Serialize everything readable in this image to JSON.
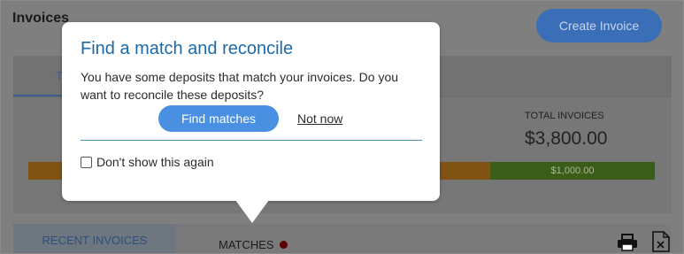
{
  "page": {
    "title": "Invoices",
    "create_button": "Create Invoice"
  },
  "summary": {
    "tab_partial": "T",
    "total_label": "TOTAL INVOICES",
    "total_value": "$3,800.00",
    "green_bar_label": "$1,000.00"
  },
  "bottom_tabs": {
    "recent": "RECENT INVOICES",
    "matches": "MATCHES"
  },
  "popup": {
    "title": "Find a match and reconcile",
    "body": "You have some deposits that match your invoices. Do you want to reconcile these deposits?",
    "find_button": "Find matches",
    "not_now": "Not now",
    "checkbox_label": "Don't show this again"
  },
  "colors": {
    "accent": "#4a90e2",
    "title_blue": "#1e6aa6",
    "bar_orange": "#805313",
    "bar_green": "#3a5e1a",
    "alert_dot": "#5a0000"
  },
  "icons": [
    "print-icon",
    "export-icon"
  ]
}
